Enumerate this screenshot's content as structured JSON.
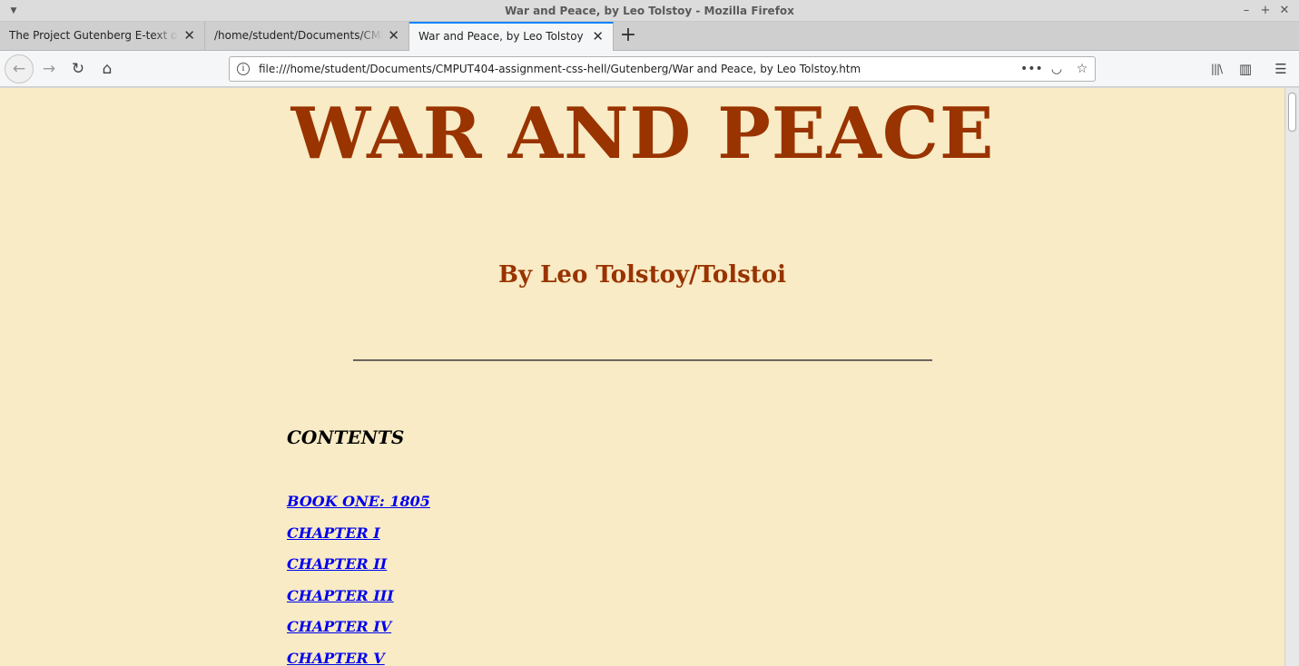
{
  "window": {
    "title": "War and Peace, by Leo Tolstoy - Mozilla Firefox",
    "controls": [
      "–",
      "+",
      "✕"
    ]
  },
  "tabs": [
    {
      "label": "The Project Gutenberg E-text of F",
      "close": "✕"
    },
    {
      "label": "/home/student/Documents/CMPU",
      "close": "✕"
    },
    {
      "label": "War and Peace, by Leo Tolstoy",
      "close": "✕",
      "active": true
    }
  ],
  "new_tab": "+",
  "navbar": {
    "back": "←",
    "forward": "→",
    "reload": "↻",
    "home": "⌂",
    "url": "file:///home/student/Documents/CMPUT404-assignment-css-hell/Gutenberg/War and Peace, by Leo Tolstoy.htm",
    "page_actions": "•••",
    "pocket": "◡",
    "bookmark": "☆",
    "library": "|||\\",
    "sidebar": "▥",
    "menu": "☰"
  },
  "page": {
    "title": "WAR AND PEACE",
    "author": "By Leo Tolstoy/Tolstoi",
    "contents_heading": "CONTENTS",
    "toc": [
      "BOOK ONE: 1805",
      "CHAPTER I",
      "CHAPTER II",
      "CHAPTER III",
      "CHAPTER IV",
      "CHAPTER V"
    ]
  },
  "colors": {
    "page_background": "#f8ebc5",
    "heading": "#993300",
    "link": "#0000ee",
    "active_tab_accent": "#0a84ff"
  }
}
